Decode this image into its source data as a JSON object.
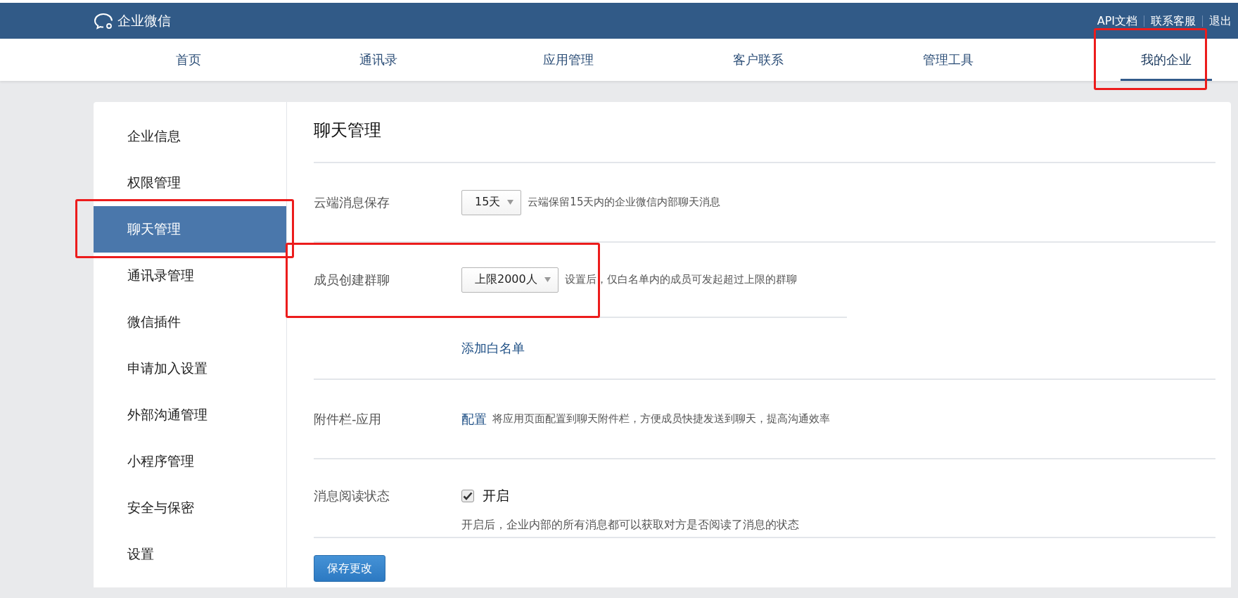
{
  "header": {
    "logo_text": "企业微信",
    "links": [
      "API文档",
      "联系客服",
      "退出"
    ]
  },
  "nav": {
    "tabs": [
      {
        "label": "首页",
        "selected": false,
        "annotated": false
      },
      {
        "label": "通讯录",
        "selected": false,
        "annotated": false
      },
      {
        "label": "应用管理",
        "selected": false,
        "annotated": false
      },
      {
        "label": "客户联系",
        "selected": false,
        "annotated": false
      },
      {
        "label": "管理工具",
        "selected": false,
        "annotated": false
      },
      {
        "label": "我的企业",
        "selected": true,
        "annotated": true
      }
    ]
  },
  "sidebar": {
    "items": [
      {
        "label": "企业信息",
        "selected": false,
        "annotated": false
      },
      {
        "label": "权限管理",
        "selected": false,
        "annotated": false
      },
      {
        "label": "聊天管理",
        "selected": true,
        "annotated": true
      },
      {
        "label": "通讯录管理",
        "selected": false,
        "annotated": false
      },
      {
        "label": "微信插件",
        "selected": false,
        "annotated": false
      },
      {
        "label": "申请加入设置",
        "selected": false,
        "annotated": false
      },
      {
        "label": "外部沟通管理",
        "selected": false,
        "annotated": false
      },
      {
        "label": "小程序管理",
        "selected": false,
        "annotated": false
      },
      {
        "label": "安全与保密",
        "selected": false,
        "annotated": false
      },
      {
        "label": "设置",
        "selected": false,
        "annotated": false
      }
    ]
  },
  "panel": {
    "title": "聊天管理",
    "rows": [
      {
        "kind": "select",
        "label": "云端消息保存",
        "value": "15天",
        "description": "云端保留15天内的企业微信内部聊天消息",
        "annotated": false
      },
      {
        "kind": "select",
        "label": "成员创建群聊",
        "value": "上限2000人",
        "description": "设置后，仅白名单内的成员可发起超过上限的群聊",
        "annotated": true,
        "link": "添加白名单"
      },
      {
        "kind": "link",
        "label": "附件栏-应用",
        "link": "配置",
        "description": "将应用页面配置到聊天附件栏，方便成员快捷发送到聊天，提高沟通效率",
        "annotated": false
      },
      {
        "kind": "checkbox",
        "label": "消息阅读状态",
        "checked": true,
        "option": "开启",
        "description": "开启后，企业内部的所有消息都可以获取对方是否阅读了消息的状态",
        "annotated": false
      }
    ],
    "save_button": "保存更改"
  }
}
